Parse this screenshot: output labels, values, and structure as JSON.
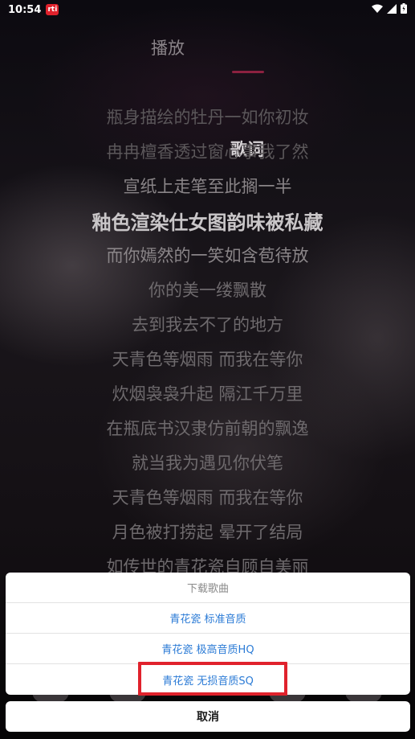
{
  "status_bar": {
    "time": "10:54",
    "notification_icon": "app-notification-icon",
    "notification_label": "rti",
    "icons": [
      "wifi-icon",
      "signal-icon",
      "battery-icon"
    ]
  },
  "tabs": [
    {
      "label": "播放",
      "active": false
    },
    {
      "label": "歌词",
      "active": true
    }
  ],
  "lyrics": [
    "瓶身描绘的牡丹一如你初妆",
    "冉冉檀香透过窗心事我了然",
    "宣纸上走笔至此搁一半",
    "釉色渲染仕女图韵味被私藏",
    "而你嫣然的一笑如含苞待放",
    "你的美一缕飘散",
    "去到我去不了的地方",
    "天青色等烟雨 而我在等你",
    "炊烟袅袅升起 隔江千万里",
    "在瓶底书汉隶仿前朝的飘逸",
    "就当我为遇见你伏笔",
    "天青色等烟雨 而我在等你",
    "月色被打捞起 晕开了结局",
    "如传世的青花瓷自顾自美丽"
  ],
  "current_lyric_index": 3,
  "download_sheet": {
    "title": "下载歌曲",
    "options": [
      "青花瓷 标准音质",
      "青花瓷 极高音质HQ",
      "青花瓷 无损音质SQ"
    ],
    "highlighted_option_index": 2,
    "highlight_color": "#e0222c",
    "option_color": "#2b7bd6",
    "cancel_label": "取消"
  }
}
